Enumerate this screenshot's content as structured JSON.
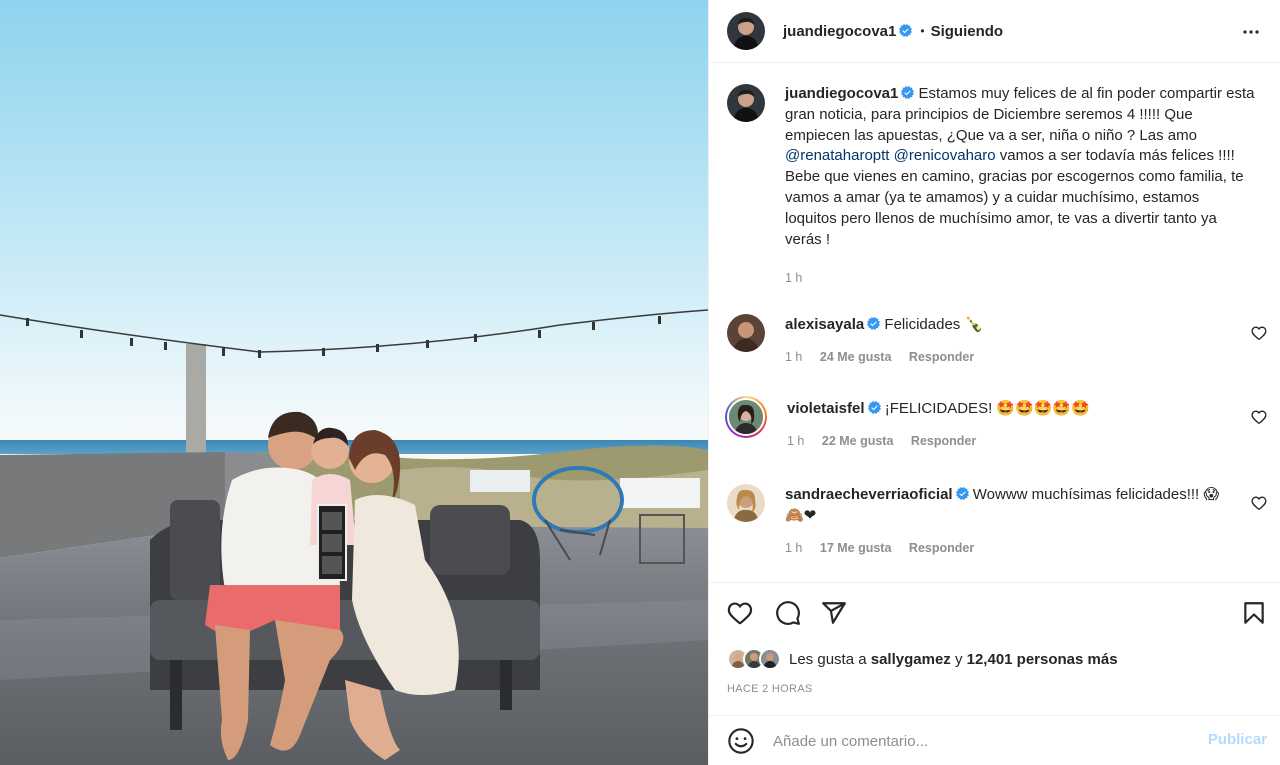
{
  "post": {
    "author": "juandiegocova1",
    "follow_status": "Siguiendo",
    "separator": "•",
    "caption_text": "Estamos muy felices de al fin poder compartir esta gran noticia, para principios de Diciembre seremos 4 !!!!! Que empiecen las apuestas, ¿Que va a ser, niña o niño ? Las amo ",
    "mention1": "@renataharoptt",
    "mention2": "@renicovaharo",
    "caption_tail": " vamos a ser todavía más felices !!!! Bebe que vienes en camino, gracias por escogernos como familia, te vamos a amar (ya te amamos) y a cuidar muchísimo, estamos loquitos pero llenos de muchísimo amor, te vas a divertir tanto ya verás !",
    "caption_time": "1 h"
  },
  "comments": [
    {
      "user": "alexisayala",
      "text": "Felicidades ",
      "emoji": "🍾",
      "time": "1 h",
      "likes": "24 Me gusta",
      "reply": "Responder"
    },
    {
      "user": "violetaisfel",
      "text": "¡FELICIDADES! ",
      "emoji": "🤩🤩🤩🤩🤩",
      "time": "1 h",
      "likes": "22 Me gusta",
      "reply": "Responder"
    },
    {
      "user": "sandraecheverriaoficial",
      "text": "Wowww muchísimas felicidades!!! ",
      "emoji": "😱🙈❤",
      "time": "1 h",
      "likes": "17 Me gusta",
      "reply": "Responder"
    }
  ],
  "likes": {
    "prefix": "Les gusta a ",
    "user": "sallygamez",
    "middle": " y ",
    "count": "12,401 personas más"
  },
  "posted_ago": "HACE 2 HORAS",
  "composer": {
    "placeholder": "Añade un comentario...",
    "publish": "Publicar"
  },
  "icons": {
    "more": "more-icon",
    "like": "heart-icon",
    "comment": "comment-icon",
    "share": "share-icon",
    "save": "bookmark-icon",
    "emoji": "emoji-icon",
    "verified": "verified-badge-icon"
  },
  "colors": {
    "verified": "#3897f0",
    "mention": "#00376b",
    "publish_disabled": "#b3dbff",
    "secondary_text": "#8e8e8e"
  }
}
